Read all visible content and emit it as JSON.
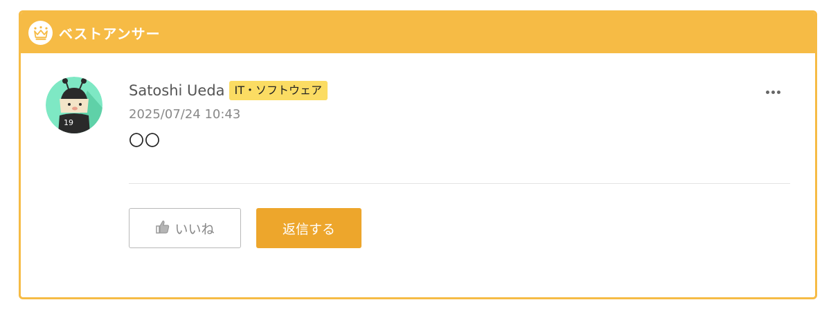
{
  "header": {
    "title": "ベストアンサー",
    "icon": "crown-icon"
  },
  "answer": {
    "author": "Satoshi Ueda",
    "category": "IT・ソフトウェア",
    "date": "2025/07/24 10:43",
    "body": "〇〇",
    "avatar_icon": "bee-mascot-avatar",
    "avatar_number": "19"
  },
  "actions": {
    "like_label": "いいね",
    "like_icon": "thumbs-up-icon",
    "reply_label": "返信する",
    "more_icon": "more-dots-icon"
  },
  "colors": {
    "accent": "#f6bb45",
    "tag": "#fbdc63",
    "reply_button": "#eda62c"
  }
}
